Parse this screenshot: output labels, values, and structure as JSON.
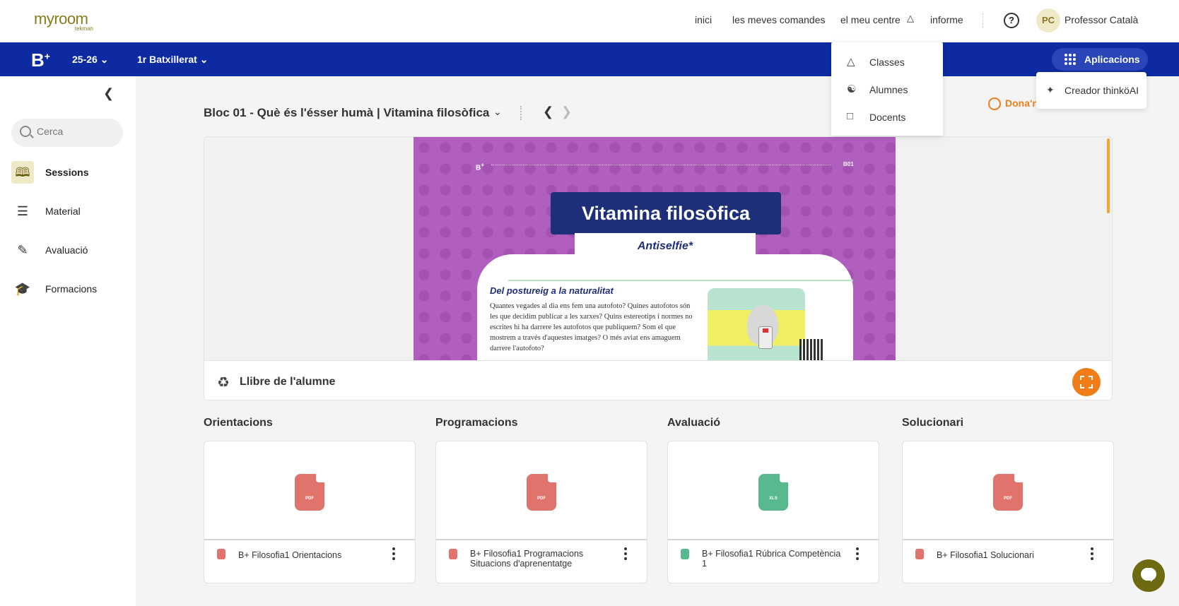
{
  "header": {
    "logo_main": "myroom",
    "logo_sub": "tekman",
    "nav": [
      "inici",
      "les meves comandes",
      "el meu centre",
      "informe"
    ],
    "help": "?",
    "avatar_initials": "PC",
    "user_name": "Professor Català"
  },
  "bluebar": {
    "brand": "B",
    "year": "25-26",
    "grade": "1r Batxillerat",
    "apps_label": "Aplicacions"
  },
  "centre_menu": {
    "items": [
      {
        "label": "Classes",
        "icon": "classes-icon"
      },
      {
        "label": "Alumnes",
        "icon": "student-icon"
      },
      {
        "label": "Docents",
        "icon": "teacher-icon"
      }
    ]
  },
  "apps_menu": {
    "items": [
      {
        "label": "Creador thinköAI",
        "icon": "sparkle-icon"
      }
    ]
  },
  "sidebar": {
    "search_placeholder": "Cerca",
    "items": [
      {
        "label": "Sessions",
        "icon": "book-icon",
        "active": true
      },
      {
        "label": "Material",
        "icon": "layers-icon"
      },
      {
        "label": "Avaluació",
        "icon": "pen-icon"
      },
      {
        "label": "Formacions",
        "icon": "graduation-cap-icon"
      }
    ]
  },
  "main": {
    "bloc_title": "Bloc 01 - Què és l'ésser humà | Vitamina filosòfica",
    "feedback": "Dona'n",
    "viewer": {
      "page_brand": "B",
      "page_code": "B01",
      "page_title": "Vitamina filosòfica",
      "page_subtitle": "Antiselfie*",
      "page_heading": "Del postureig a la naturalitat",
      "page_body": "Quantes vegades al dia ens fem una autofoto? Quines autofotos són les que decidim publicar a les xarxes? Quins estereotips i normes no escrites hi ha darrere les autofotos que publiquem? Som el que mostrem a través d'aquestes imatges? O més aviat ens amaguem darrere l'autofoto?",
      "bar_label": "Llibre de l'alumne"
    },
    "sections": [
      {
        "title": "Orientacions",
        "file_type": "pdf",
        "file_label": "PDF",
        "file_name": "B+ Filosofia1 Orientacions"
      },
      {
        "title": "Programacions",
        "file_type": "pdf",
        "file_label": "PDF",
        "file_name": "B+ Filosofia1 Programacions Situacions d'aprenentatge"
      },
      {
        "title": "Avaluació",
        "file_type": "xls",
        "file_label": "XLS",
        "file_name": "B+ Filosofia1 Rúbrica Competència 1"
      },
      {
        "title": "Solucionari",
        "file_type": "pdf",
        "file_label": "PDF",
        "file_name": "B+ Filosofia1 Solucionari"
      }
    ]
  },
  "colors": {
    "brand_blue": "#0d2aa0",
    "accent_orange": "#f07d17",
    "olive": "#8a7a1e",
    "pdf_red": "#e0736c",
    "xls_green": "#58b98f",
    "page_purple": "#b05fbe"
  }
}
